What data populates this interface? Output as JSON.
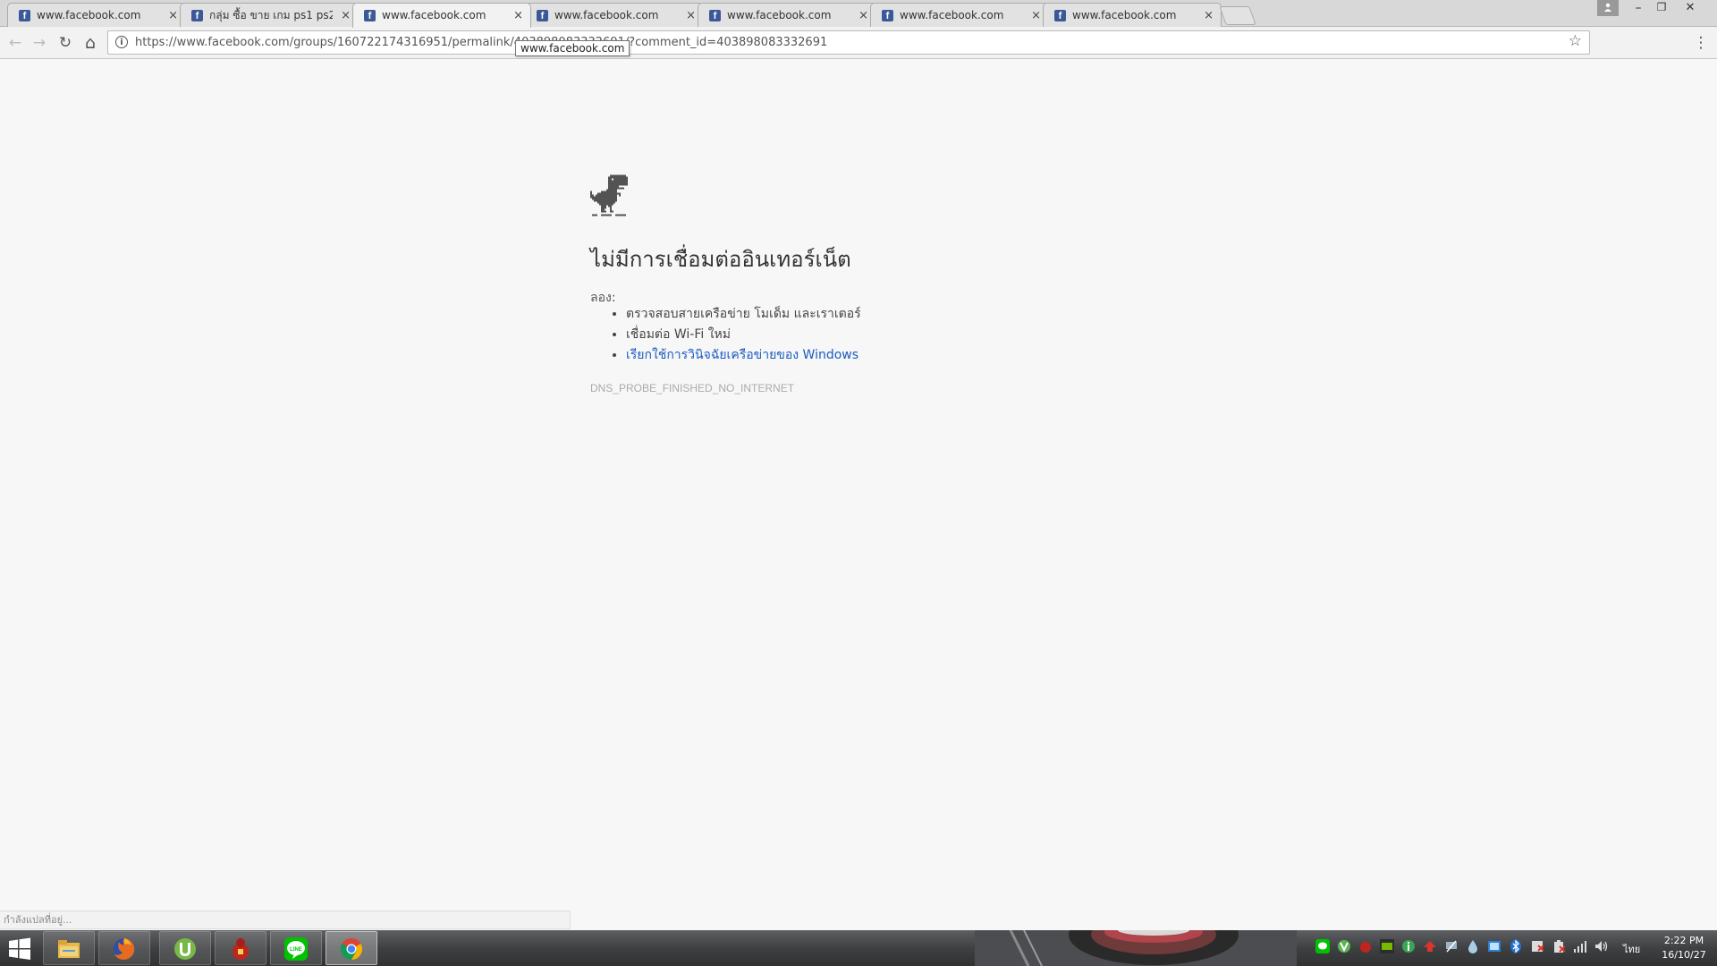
{
  "tabs": [
    {
      "title": "www.facebook.com",
      "favicon": "facebook-icon",
      "active": false
    },
    {
      "title": "กลุ่ม ซื้อ ขาย เกม ps1 ps2 ...",
      "favicon": "facebook-icon",
      "active": false
    },
    {
      "title": "www.facebook.com",
      "favicon": "facebook-icon",
      "active": true
    },
    {
      "title": "www.facebook.com",
      "favicon": "facebook-icon",
      "active": false
    },
    {
      "title": "www.facebook.com",
      "favicon": "facebook-icon",
      "active": false
    },
    {
      "title": "www.facebook.com",
      "favicon": "facebook-icon",
      "active": false
    },
    {
      "title": "www.facebook.com",
      "favicon": "facebook-icon",
      "active": false
    }
  ],
  "tab_close_glyph": "×",
  "favicon_letter": "f",
  "window_controls": {
    "minimize": "–",
    "restore": "❐",
    "close": "✕"
  },
  "toolbar": {
    "back": "←",
    "forward": "→",
    "reload": "↻",
    "home": "⌂",
    "url": "https://www.facebook.com/groups/160722174316951/permalink/403898083332691/?comment_id=403898083332691",
    "info": "i",
    "bookmark": "☆",
    "menu": "⋮"
  },
  "tooltip": "www.facebook.com",
  "error": {
    "heading": "ไม่มีการเชื่อมต่ออินเทอร์เน็ต",
    "try_label": "ลอง:",
    "suggestions": [
      {
        "text": "ตรวจสอบสายเครือข่าย โมเด็ม และเราเตอร์",
        "link": false
      },
      {
        "text": "เชื่อมต่อ Wi-Fi ใหม่",
        "link": false
      },
      {
        "text": "เรียกใช้การวินิจฉัยเครือข่ายของ Windows",
        "link": true
      }
    ],
    "code": "DNS_PROBE_FINISHED_NO_INTERNET"
  },
  "status_bubble": "กำลังแปลที่อยู่...",
  "taskbar": {
    "apps": [
      "file-explorer-icon",
      "firefox-icon",
      "utorrent-icon",
      "red-app-icon",
      "line-icon",
      "chrome-icon"
    ],
    "line_label": "LINE",
    "ime": "ไทย",
    "clock_time": "2:22 PM",
    "clock_date": "16/10/27"
  },
  "colors": {
    "facebook": "#3b5998",
    "link": "#1a5bbf",
    "page_bg": "#f7f7f7",
    "line_green": "#00c300"
  }
}
